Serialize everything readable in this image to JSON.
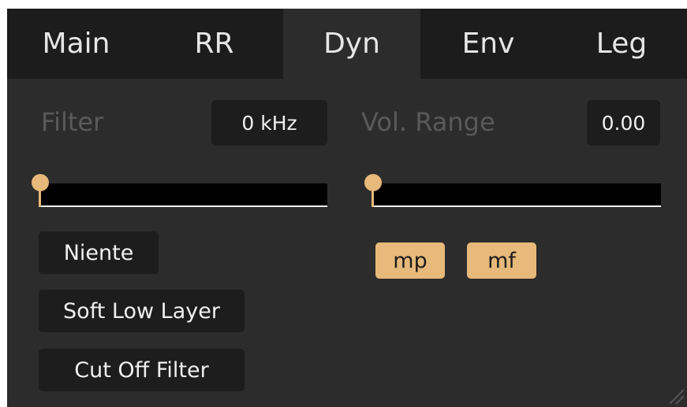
{
  "tabs": [
    {
      "label": "Main"
    },
    {
      "label": "RR"
    },
    {
      "label": "Dyn"
    },
    {
      "label": "Env"
    },
    {
      "label": "Leg"
    }
  ],
  "active_tab": "Dyn",
  "filter": {
    "label": "Filter",
    "value": "0 kHz",
    "slider_level": 0
  },
  "vol_range": {
    "label": "Vol. Range",
    "value": "0.00",
    "slider_level": 0
  },
  "layer_buttons": [
    {
      "label": "Niente"
    },
    {
      "label": "Soft Low Layer"
    },
    {
      "label": "Cut Off Filter"
    }
  ],
  "dyn_buttons": [
    {
      "label": "mp",
      "active": true
    },
    {
      "label": "mf",
      "active": true
    }
  ],
  "colors": {
    "background": "#2c2c2c",
    "tab_bar": "#1c1c1c",
    "accent": "#e7b97a",
    "field": "#1d1d1d",
    "label_dim": "#5a5a5a"
  }
}
